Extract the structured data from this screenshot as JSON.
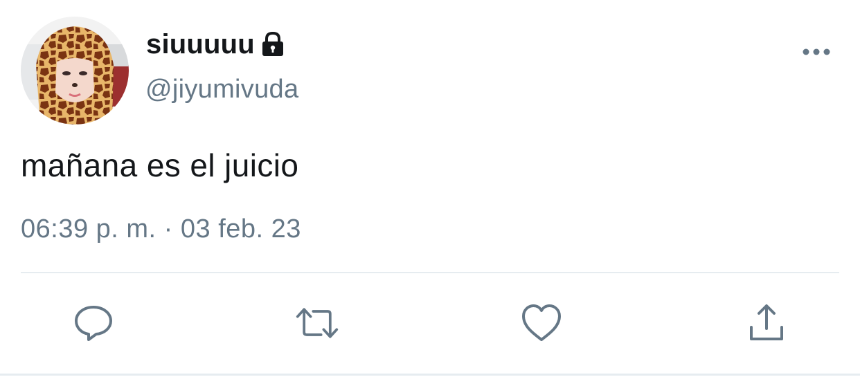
{
  "user": {
    "display_name": "siuuuuu",
    "handle": "@jiyumivuda",
    "avatar": "profile-photo",
    "protected_icon": "lock-icon"
  },
  "tweet": {
    "text": "mañana es el juicio",
    "timestamp": "06:39 p. m. · 03 feb. 23"
  },
  "menu_icon": "more-horizontal-icon",
  "actions": {
    "reply_icon": "reply-icon",
    "retweet_icon": "retweet-icon",
    "like_icon": "heart-icon",
    "share_icon": "share-icon"
  },
  "colors": {
    "text_primary": "#14171a",
    "text_secondary": "#657786",
    "divider": "#e6ecf0"
  }
}
